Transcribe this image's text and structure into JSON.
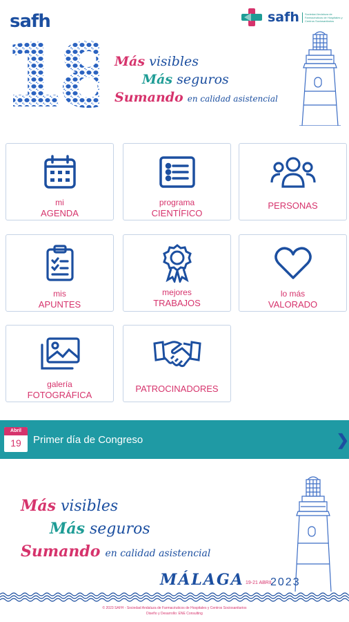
{
  "header": {
    "brand": "safh",
    "edition": "18",
    "org_name": "safh",
    "org_desc": "Sociedad Andaluza de Farmacéuticos de Hospitales y Centros Sociosanitarios",
    "slogan": {
      "w1a": "Más",
      "w1b": "visibles",
      "w2a": "Más",
      "w2b": "seguros",
      "w3a": "Sumando",
      "w3b": "en calidad asistencial"
    }
  },
  "menu": [
    {
      "sub": "mi",
      "main": "AGENDA",
      "icon": "calendar-icon"
    },
    {
      "sub": "programa",
      "main": "CIENTÍFICO",
      "icon": "list-icon"
    },
    {
      "sub": "",
      "main": "PERSONAS",
      "icon": "people-icon"
    },
    {
      "sub": "mis",
      "main": "APUNTES",
      "icon": "clipboard-icon"
    },
    {
      "sub": "mejores",
      "main": "TRABAJOS",
      "icon": "award-icon"
    },
    {
      "sub": "lo más",
      "main": "VALORADO",
      "icon": "heart-icon"
    },
    {
      "sub": "galería",
      "main": "FOTOGRÁFICA",
      "icon": "photos-icon"
    },
    {
      "sub": "",
      "main": "PATROCINADORES",
      "icon": "handshake-icon"
    }
  ],
  "banner": {
    "month": "Abril",
    "day": "19",
    "title": "Primer día de Congreso"
  },
  "footer": {
    "slogan": {
      "w1a": "Más",
      "w1b": "visibles",
      "w2a": "Más",
      "w2b": "seguros",
      "w3a": "Sumando",
      "w3b": "en calidad asistencial"
    },
    "city": "MÁLAGA",
    "dates": "19-21 ABRIL",
    "year": "2023",
    "credits_1": "© 2023 SAFH - Sociedad Andaluza de Farmacéuticos de Hospitales y Centros Sociosanitarios",
    "credits_2": "Diseño y Desarrollo: ENE Consulting"
  },
  "colors": {
    "primary": "#1c4fa0",
    "accent": "#d6336c",
    "teal": "#1f9aa4"
  }
}
